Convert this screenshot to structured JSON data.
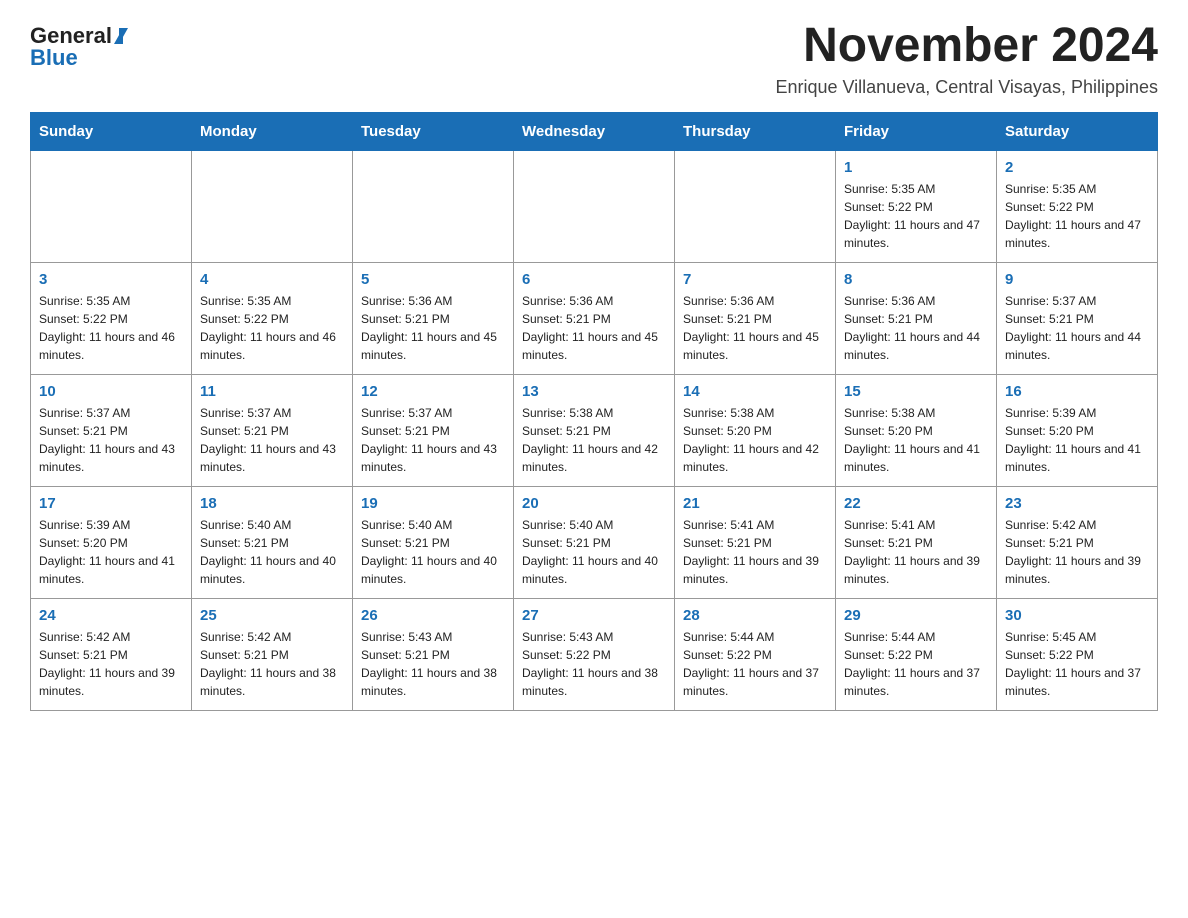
{
  "logo": {
    "general": "General",
    "blue": "Blue"
  },
  "header": {
    "month_title": "November 2024",
    "subtitle": "Enrique Villanueva, Central Visayas, Philippines"
  },
  "days_of_week": [
    "Sunday",
    "Monday",
    "Tuesday",
    "Wednesday",
    "Thursday",
    "Friday",
    "Saturday"
  ],
  "weeks": [
    [
      {
        "day": "",
        "info": ""
      },
      {
        "day": "",
        "info": ""
      },
      {
        "day": "",
        "info": ""
      },
      {
        "day": "",
        "info": ""
      },
      {
        "day": "",
        "info": ""
      },
      {
        "day": "1",
        "info": "Sunrise: 5:35 AM\nSunset: 5:22 PM\nDaylight: 11 hours and 47 minutes."
      },
      {
        "day": "2",
        "info": "Sunrise: 5:35 AM\nSunset: 5:22 PM\nDaylight: 11 hours and 47 minutes."
      }
    ],
    [
      {
        "day": "3",
        "info": "Sunrise: 5:35 AM\nSunset: 5:22 PM\nDaylight: 11 hours and 46 minutes."
      },
      {
        "day": "4",
        "info": "Sunrise: 5:35 AM\nSunset: 5:22 PM\nDaylight: 11 hours and 46 minutes."
      },
      {
        "day": "5",
        "info": "Sunrise: 5:36 AM\nSunset: 5:21 PM\nDaylight: 11 hours and 45 minutes."
      },
      {
        "day": "6",
        "info": "Sunrise: 5:36 AM\nSunset: 5:21 PM\nDaylight: 11 hours and 45 minutes."
      },
      {
        "day": "7",
        "info": "Sunrise: 5:36 AM\nSunset: 5:21 PM\nDaylight: 11 hours and 45 minutes."
      },
      {
        "day": "8",
        "info": "Sunrise: 5:36 AM\nSunset: 5:21 PM\nDaylight: 11 hours and 44 minutes."
      },
      {
        "day": "9",
        "info": "Sunrise: 5:37 AM\nSunset: 5:21 PM\nDaylight: 11 hours and 44 minutes."
      }
    ],
    [
      {
        "day": "10",
        "info": "Sunrise: 5:37 AM\nSunset: 5:21 PM\nDaylight: 11 hours and 43 minutes."
      },
      {
        "day": "11",
        "info": "Sunrise: 5:37 AM\nSunset: 5:21 PM\nDaylight: 11 hours and 43 minutes."
      },
      {
        "day": "12",
        "info": "Sunrise: 5:37 AM\nSunset: 5:21 PM\nDaylight: 11 hours and 43 minutes."
      },
      {
        "day": "13",
        "info": "Sunrise: 5:38 AM\nSunset: 5:21 PM\nDaylight: 11 hours and 42 minutes."
      },
      {
        "day": "14",
        "info": "Sunrise: 5:38 AM\nSunset: 5:20 PM\nDaylight: 11 hours and 42 minutes."
      },
      {
        "day": "15",
        "info": "Sunrise: 5:38 AM\nSunset: 5:20 PM\nDaylight: 11 hours and 41 minutes."
      },
      {
        "day": "16",
        "info": "Sunrise: 5:39 AM\nSunset: 5:20 PM\nDaylight: 11 hours and 41 minutes."
      }
    ],
    [
      {
        "day": "17",
        "info": "Sunrise: 5:39 AM\nSunset: 5:20 PM\nDaylight: 11 hours and 41 minutes."
      },
      {
        "day": "18",
        "info": "Sunrise: 5:40 AM\nSunset: 5:21 PM\nDaylight: 11 hours and 40 minutes."
      },
      {
        "day": "19",
        "info": "Sunrise: 5:40 AM\nSunset: 5:21 PM\nDaylight: 11 hours and 40 minutes."
      },
      {
        "day": "20",
        "info": "Sunrise: 5:40 AM\nSunset: 5:21 PM\nDaylight: 11 hours and 40 minutes."
      },
      {
        "day": "21",
        "info": "Sunrise: 5:41 AM\nSunset: 5:21 PM\nDaylight: 11 hours and 39 minutes."
      },
      {
        "day": "22",
        "info": "Sunrise: 5:41 AM\nSunset: 5:21 PM\nDaylight: 11 hours and 39 minutes."
      },
      {
        "day": "23",
        "info": "Sunrise: 5:42 AM\nSunset: 5:21 PM\nDaylight: 11 hours and 39 minutes."
      }
    ],
    [
      {
        "day": "24",
        "info": "Sunrise: 5:42 AM\nSunset: 5:21 PM\nDaylight: 11 hours and 39 minutes."
      },
      {
        "day": "25",
        "info": "Sunrise: 5:42 AM\nSunset: 5:21 PM\nDaylight: 11 hours and 38 minutes."
      },
      {
        "day": "26",
        "info": "Sunrise: 5:43 AM\nSunset: 5:21 PM\nDaylight: 11 hours and 38 minutes."
      },
      {
        "day": "27",
        "info": "Sunrise: 5:43 AM\nSunset: 5:22 PM\nDaylight: 11 hours and 38 minutes."
      },
      {
        "day": "28",
        "info": "Sunrise: 5:44 AM\nSunset: 5:22 PM\nDaylight: 11 hours and 37 minutes."
      },
      {
        "day": "29",
        "info": "Sunrise: 5:44 AM\nSunset: 5:22 PM\nDaylight: 11 hours and 37 minutes."
      },
      {
        "day": "30",
        "info": "Sunrise: 5:45 AM\nSunset: 5:22 PM\nDaylight: 11 hours and 37 minutes."
      }
    ]
  ]
}
